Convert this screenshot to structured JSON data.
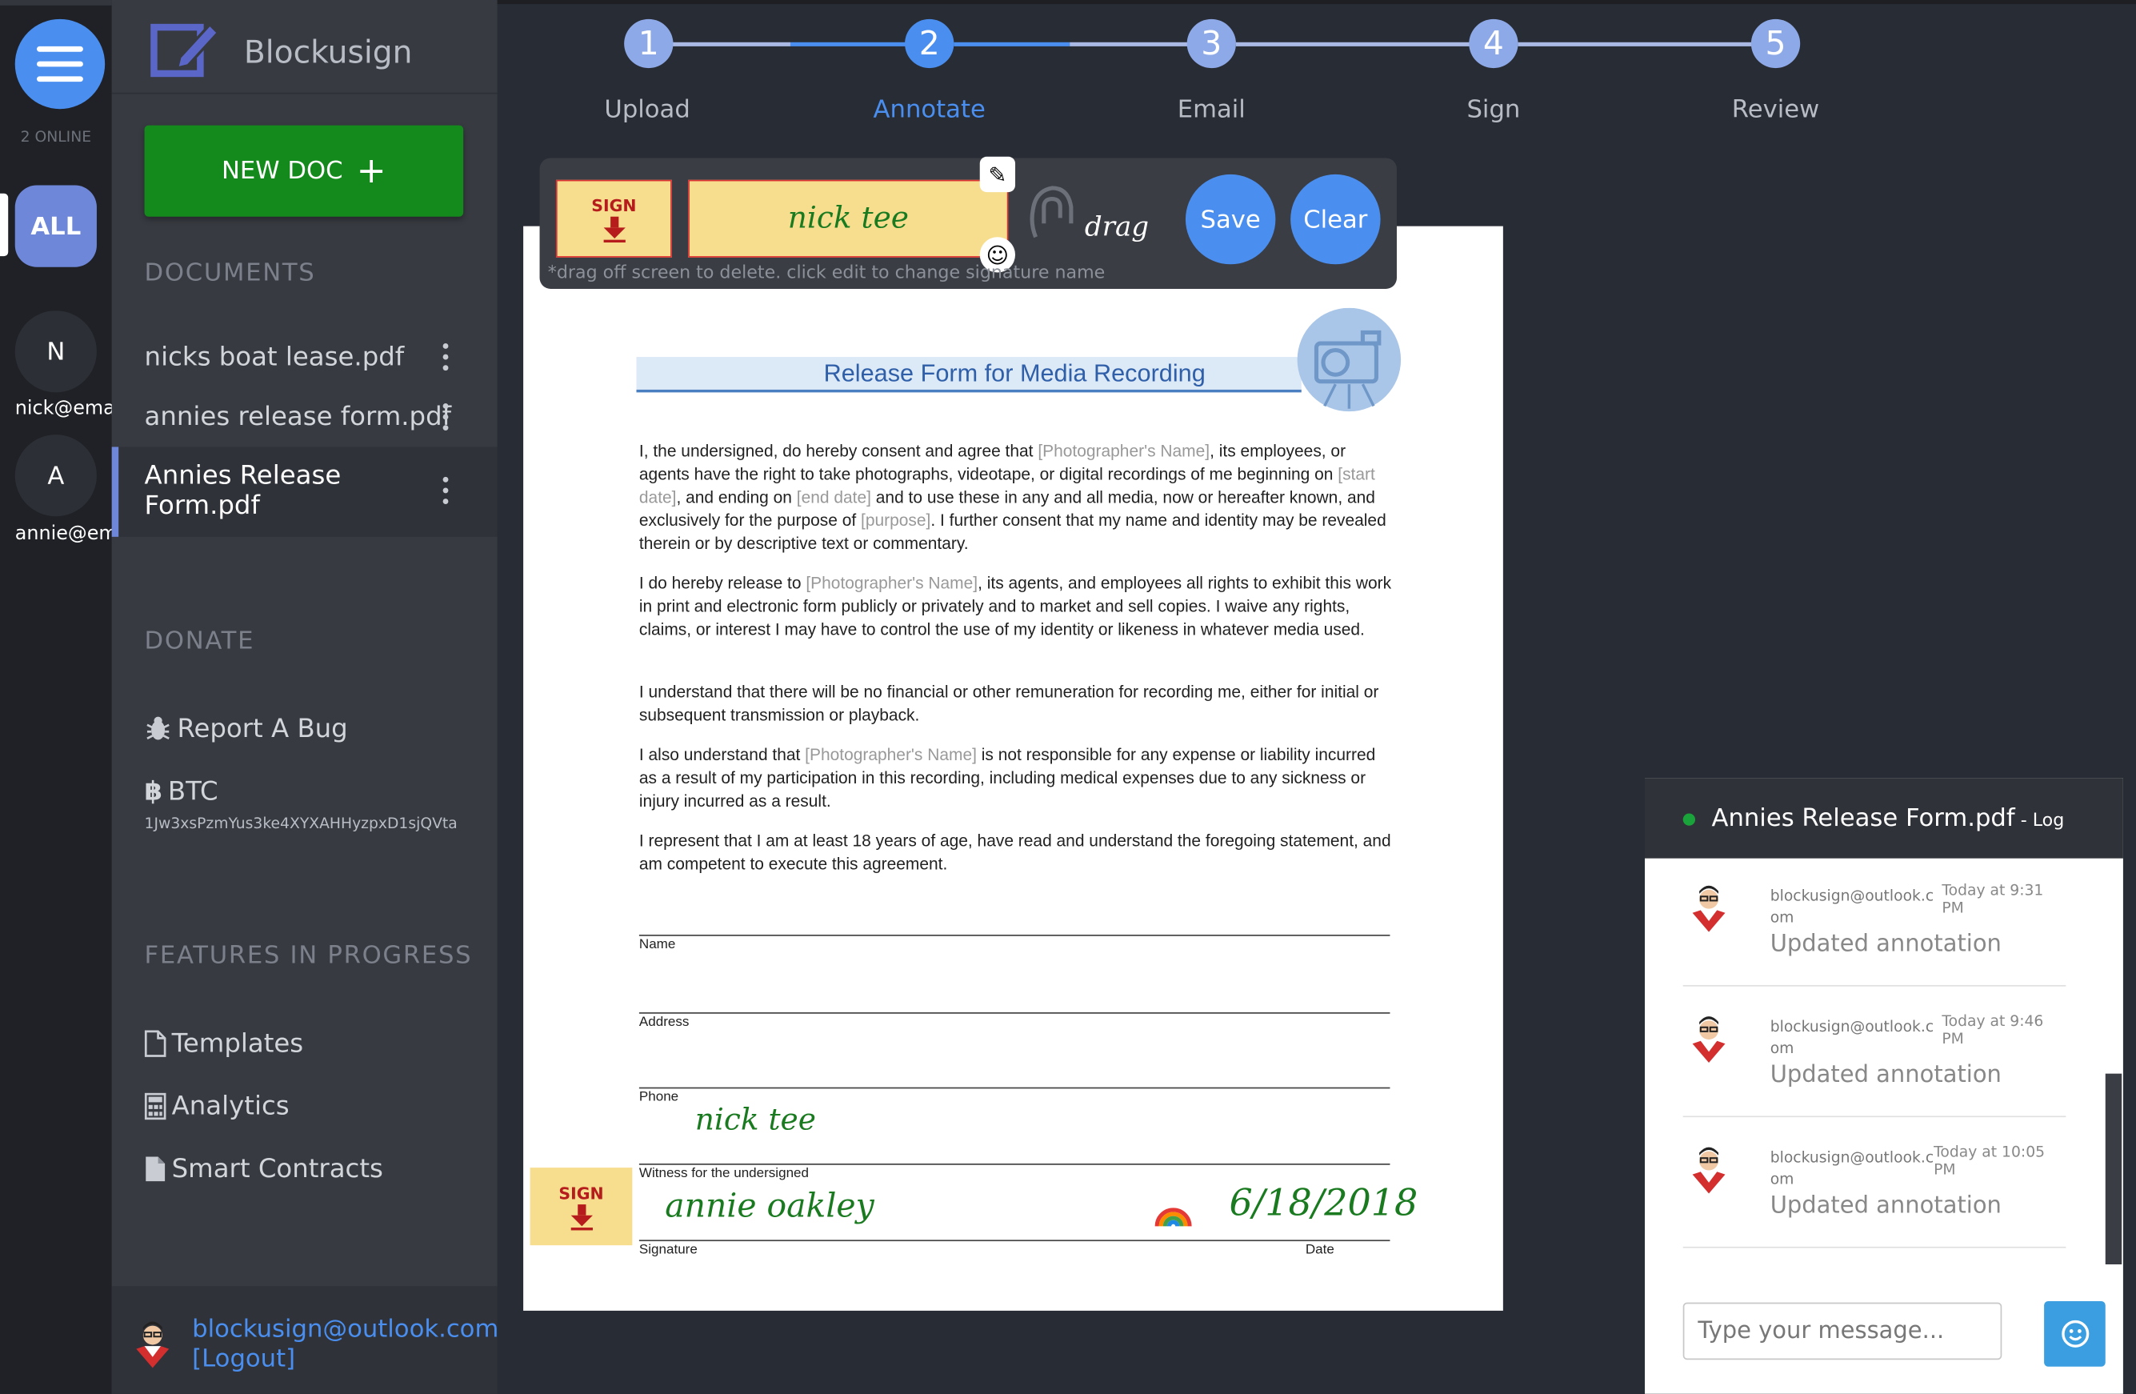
{
  "rail": {
    "online_label": "2 ONLINE",
    "all_label": "ALL",
    "users": [
      {
        "initial": "N",
        "email": "nick@email.com"
      },
      {
        "initial": "A",
        "email": "annie@email.com"
      }
    ]
  },
  "sidebar": {
    "app_name": "Blockusign",
    "new_doc_label": "NEW DOC",
    "documents_heading": "DOCUMENTS",
    "documents": [
      {
        "name": "nicks boat lease.pdf"
      },
      {
        "name": "annies release form.pdf"
      },
      {
        "name": "Annies Release Form.pdf"
      }
    ],
    "donate_heading": "DONATE",
    "report_bug_label": "Report A Bug",
    "btc_label": "BTC",
    "btc_address": "1Jw3xsPzmYus3ke4XYXAHHyzpxD1sjQVta",
    "features_heading": "FEATURES IN PROGRESS",
    "features": [
      {
        "label": "Templates"
      },
      {
        "label": "Analytics"
      },
      {
        "label": "Smart Contracts"
      }
    ],
    "footer_email": "blockusign@outlook.com",
    "footer_logout": "[Logout]"
  },
  "steps": [
    {
      "number": "1",
      "label": "Upload"
    },
    {
      "number": "2",
      "label": "Annotate"
    },
    {
      "number": "3",
      "label": "Email"
    },
    {
      "number": "4",
      "label": "Sign"
    },
    {
      "number": "5",
      "label": "Review"
    }
  ],
  "active_step": "Annotate",
  "toolbar": {
    "sign_label": "SIGN",
    "signature_name": "nick tee",
    "drag_label": "drag",
    "save_label": "Save",
    "clear_label": "Clear",
    "hint": "*drag off screen to delete. click edit to change signature name"
  },
  "document": {
    "title": "Release Form for Media Recording",
    "p1": {
      "a": "I, the undersigned, do hereby consent and agree that ",
      "b": "[Photographer's Name]",
      "c": ", its employees, or agents have the right to take photographs, videotape, or digital recordings of me beginning on ",
      "d": "[start date]",
      "e": ", and ending on ",
      "f": "[end date]",
      "g": " and to use these in any and all media, now or hereafter known, and exclusively for the purpose of ",
      "h": "[purpose]",
      "i": ". I further consent that my name and identity may be revealed therein or by descriptive text or commentary."
    },
    "p2": {
      "a": "I do hereby release to ",
      "b": "[Photographer's Name]",
      "c": ", its agents, and employees all rights to exhibit this work in print and electronic form publicly or privately and to market and sell copies. I waive any rights, claims, or interest I may have to control the use of my identity or likeness in whatever media used."
    },
    "p3": "I understand that there will be no financial or other remuneration for recording me, either for initial or subsequent transmission or playback.",
    "p4": {
      "a": "I also understand that ",
      "b": "[Photographer's Name]",
      "c": " is not responsible for any expense or liability incurred as a result of my participation in this recording, including medical expenses due to any sickness or injury incurred as a result."
    },
    "p5": "I represent that I am at least 18 years of age, have read and understand the foregoing statement, and am competent to execute this agreement.",
    "fields": {
      "name": "Name",
      "address": "Address",
      "phone": "Phone",
      "witness": "Witness for the undersigned",
      "signature": "Signature",
      "date": "Date"
    },
    "witness_signature": "nick tee",
    "signer_signature": "annie oakley",
    "sign_date": "6/18/2018",
    "sign_label": "SIGN"
  },
  "log": {
    "title": "Annies Release Form.pdf",
    "suffix": " - Log",
    "entries": [
      {
        "email": "blockusign@outlook.com",
        "time": "Today at 9:31 PM",
        "text": "Updated annotation"
      },
      {
        "email": "blockusign@outlook.com",
        "time": "Today at 9:46 PM",
        "text": "Updated annotation"
      },
      {
        "email": "blockusign@outlook.com",
        "time": "Today at 10:05 PM",
        "text": "Updated annotation"
      }
    ],
    "message_placeholder": "Type your message..."
  },
  "colors": {
    "accent": "#4a8ff0",
    "new_doc": "#138a1b",
    "online_dot": "#1aa33a",
    "signature": "#1a7a20"
  }
}
